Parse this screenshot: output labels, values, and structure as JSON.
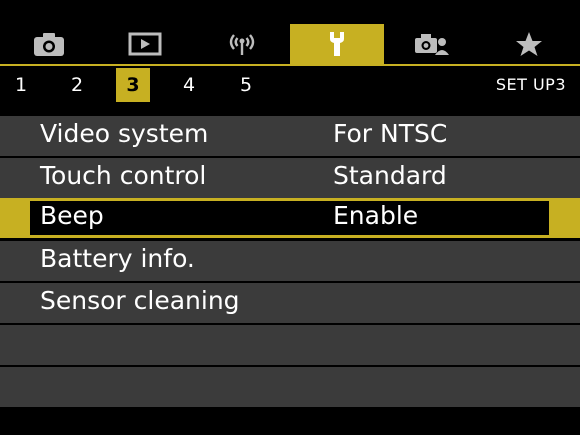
{
  "tabs": [
    {
      "icon": "camera-icon",
      "label": ""
    },
    {
      "icon": "playback-icon",
      "label": ""
    },
    {
      "icon": "wireless-icon",
      "label": ""
    },
    {
      "icon": "wrench-icon",
      "label": "",
      "active": true
    },
    {
      "icon": "custom-functions-icon",
      "label": ""
    },
    {
      "icon": "star-icon",
      "label": ""
    }
  ],
  "pages": [
    "1",
    "2",
    "3",
    "4",
    "5"
  ],
  "active_page": "3",
  "menu_label": "SET UP3",
  "items": [
    {
      "name": "Video system",
      "value": "For NTSC"
    },
    {
      "name": "Touch control",
      "value": "Standard"
    },
    {
      "name": "Beep",
      "value": "Enable",
      "selected": true
    },
    {
      "name": "Battery info.",
      "value": ""
    },
    {
      "name": "Sensor cleaning",
      "value": ""
    }
  ],
  "colors": {
    "accent": "#c7b022",
    "row_bg": "#3b3b3b",
    "background": "#000000"
  }
}
